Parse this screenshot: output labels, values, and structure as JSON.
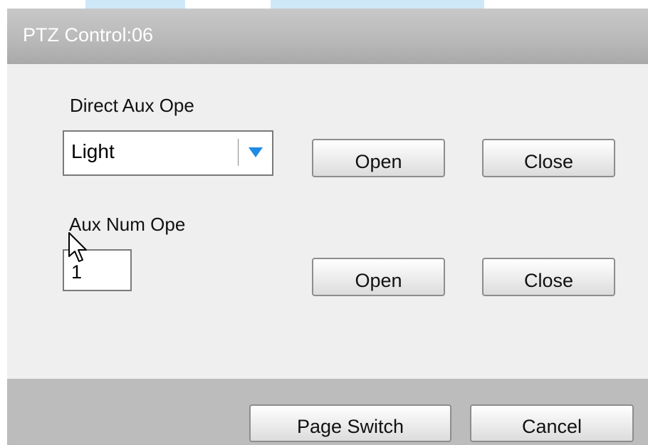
{
  "dialog": {
    "title": "PTZ Control:06"
  },
  "direct_aux": {
    "label": "Direct Aux Ope",
    "selected_option": "Light",
    "open_label": "Open",
    "close_label": "Close"
  },
  "aux_num": {
    "label": "Aux Num Ope",
    "value": "1",
    "open_label": "Open",
    "close_label": "Close"
  },
  "footer": {
    "page_switch_label": "Page Switch",
    "cancel_label": "Cancel"
  },
  "colors": {
    "dropdown_arrow": "#1e8be6",
    "title_text": "#ffffff"
  },
  "icons": {
    "dropdown": "triangle-down-icon",
    "pointer": "mouse-pointer-icon"
  }
}
